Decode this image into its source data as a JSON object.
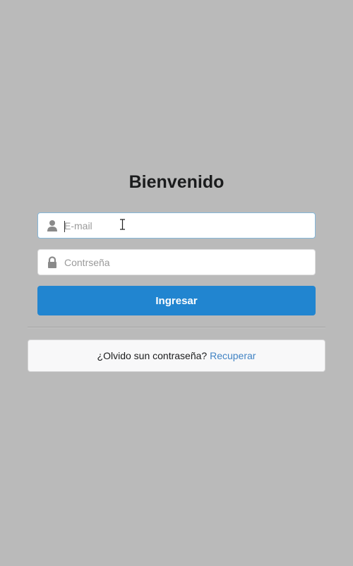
{
  "login": {
    "title": "Bienvenido",
    "email": {
      "placeholder": "E-mail",
      "value": "",
      "icon": "user-icon"
    },
    "password": {
      "placeholder": "Contrseña",
      "value": "",
      "icon": "lock-icon"
    },
    "submit_label": "Ingresar",
    "forgot": {
      "prompt": "¿Olvido sun contraseña?",
      "link_label": "Recuperar"
    }
  },
  "colors": {
    "background": "#bababa",
    "primary_button": "#2185d0",
    "link": "#4183c4",
    "focus_border": "#85b7d9"
  }
}
